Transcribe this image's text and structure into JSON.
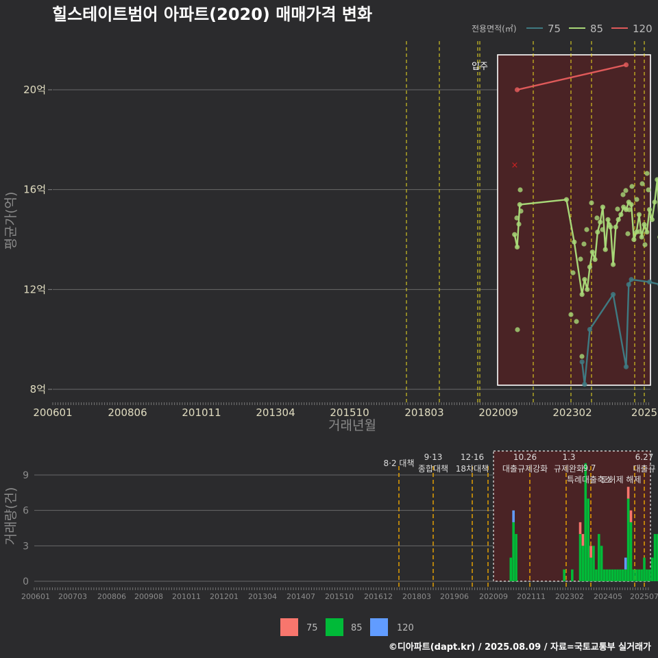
{
  "title": "힐스테이트범어 아파트(2020) 매매가격 변화",
  "footer": "©디아파트(dapt.kr) / 2025.08.09 / 자료=국토교통부 실거래가",
  "legend_top": {
    "title": "전용면적(㎡)",
    "items": [
      {
        "label": "75",
        "color": "#3f7a82"
      },
      {
        "label": "85",
        "color": "#a8d878"
      },
      {
        "label": "120",
        "color": "#e05a5a"
      }
    ]
  },
  "legend_bottom": {
    "items": [
      {
        "label": "75",
        "color": "#f8766d"
      },
      {
        "label": "85",
        "color": "#00ba38"
      },
      {
        "label": "120",
        "color": "#619cff"
      }
    ]
  },
  "chart_data": [
    {
      "type": "line",
      "xlabel": "거래년월",
      "ylabel": "평균가(억)",
      "x_ticks": [
        "200601",
        "200806",
        "201011",
        "201304",
        "201510",
        "201803",
        "202009",
        "202302",
        "2025"
      ],
      "y_ticks": [
        "8억",
        "12억",
        "16억",
        "20억"
      ],
      "ylim": [
        7.6,
        21.8
      ],
      "annotation": "입주",
      "policy_dates": [
        "2017-08",
        "2018-09",
        "2019-12",
        "2020-07",
        "2021-10",
        "2023-01",
        "2023-09",
        "2024-11",
        "2025-06"
      ],
      "series": [
        {
          "name": "75",
          "color": "#3f7a82",
          "x": [
            "2023-01",
            "2023-02",
            "2023-04",
            "2024-01",
            "2024-06",
            "2024-07",
            "2024-08",
            "2025-03",
            "2025-07"
          ],
          "y": [
            9.1,
            8.2,
            10.4,
            11.8,
            8.9,
            12.2,
            12.4,
            12.3,
            12.2
          ]
        },
        {
          "name": "85",
          "color": "#a8d878",
          "x": [
            "2020-11",
            "2020-12",
            "2021-01",
            "2022-07",
            "2022-10",
            "2023-01",
            "2023-02",
            "2023-03",
            "2023-04",
            "2023-05",
            "2023-06",
            "2023-07",
            "2023-08",
            "2023-09",
            "2023-10",
            "2023-11",
            "2023-12",
            "2024-01",
            "2024-02",
            "2024-03",
            "2024-04",
            "2024-05",
            "2024-06",
            "2024-07",
            "2024-08",
            "2024-09",
            "2024-10",
            "2024-11",
            "2024-12",
            "2025-01",
            "2025-02",
            "2025-03",
            "2025-04",
            "2025-05",
            "2025-06",
            "2025-07",
            "2025-08"
          ],
          "y": [
            14.2,
            13.7,
            15.4,
            15.6,
            13.9,
            11.8,
            12.4,
            12.0,
            12.9,
            13.5,
            13.2,
            14.3,
            14.7,
            15.3,
            13.6,
            14.8,
            14.5,
            13.0,
            14.5,
            14.8,
            15.0,
            15.3,
            15.2,
            15.5,
            15.4,
            14.0,
            14.3,
            15.0,
            14.1,
            14.6,
            14.3,
            15.2,
            14.8,
            15.5,
            16.4,
            14.1,
            15.4
          ]
        },
        {
          "name": "120",
          "color": "#e05a5a",
          "x": [
            "2020-12",
            "2024-06"
          ],
          "y": [
            20.0,
            21.0
          ]
        }
      ]
    },
    {
      "type": "bar",
      "ylabel": "거래량(건)",
      "x_ticks": [
        "200601",
        "200703",
        "200806",
        "200908",
        "201011",
        "201201",
        "201304",
        "201407",
        "201510",
        "201612",
        "201803",
        "201906",
        "202009",
        "202111",
        "202302",
        "202405",
        "202507"
      ],
      "y_ticks": [
        "0",
        "3",
        "6",
        "9"
      ],
      "ylim": [
        0,
        11
      ],
      "policy_labels": [
        {
          "line1": "8·2 대책",
          "line2": ""
        },
        {
          "line1": "9·13",
          "line2": "종합대책"
        },
        {
          "line1": "12·16",
          "line2": "18차대책"
        },
        {
          "line1": "10.26",
          "line2": "대출규제강화"
        },
        {
          "line1": "1.3",
          "line2": "규제완화"
        },
        {
          "line1": "9.7",
          "line2": "특례대출축소"
        },
        {
          "line1": "",
          "line2": "토허제 해제"
        },
        {
          "line1": "6.27",
          "line2": "대출규"
        }
      ],
      "series": [
        {
          "name": "75",
          "color": "#f8766d",
          "x": [
            "2023-01",
            "2023-02",
            "2023-05",
            "2024-07",
            "2024-08",
            "2025-07"
          ],
          "y": [
            1,
            1,
            1,
            1,
            1,
            1
          ]
        },
        {
          "name": "85",
          "color": "#00ba38",
          "x": [
            "2020-11",
            "2020-12",
            "2021-01",
            "2022-07",
            "2022-10",
            "2023-01",
            "2023-02",
            "2023-03",
            "2023-04",
            "2023-05",
            "2023-06",
            "2023-07",
            "2023-08",
            "2023-09",
            "2023-10",
            "2023-11",
            "2023-12",
            "2024-01",
            "2024-02",
            "2024-03",
            "2024-04",
            "2024-05",
            "2024-06",
            "2024-07",
            "2024-08",
            "2024-09",
            "2024-10",
            "2024-11",
            "2024-12",
            "2025-01",
            "2025-02",
            "2025-03",
            "2025-04",
            "2025-05",
            "2025-06",
            "2025-07",
            "2025-08"
          ],
          "y": [
            2,
            5,
            4,
            1,
            1,
            4,
            3,
            10,
            7,
            2,
            3,
            1,
            4,
            3,
            1,
            1,
            1,
            1,
            1,
            1,
            1,
            1,
            1,
            7,
            5,
            1,
            1,
            1,
            1,
            2,
            1,
            1,
            2,
            4,
            4,
            6,
            3
          ]
        },
        {
          "name": "120",
          "color": "#619cff",
          "x": [
            "2020-12",
            "2024-06"
          ],
          "y": [
            1,
            1
          ]
        }
      ]
    }
  ]
}
